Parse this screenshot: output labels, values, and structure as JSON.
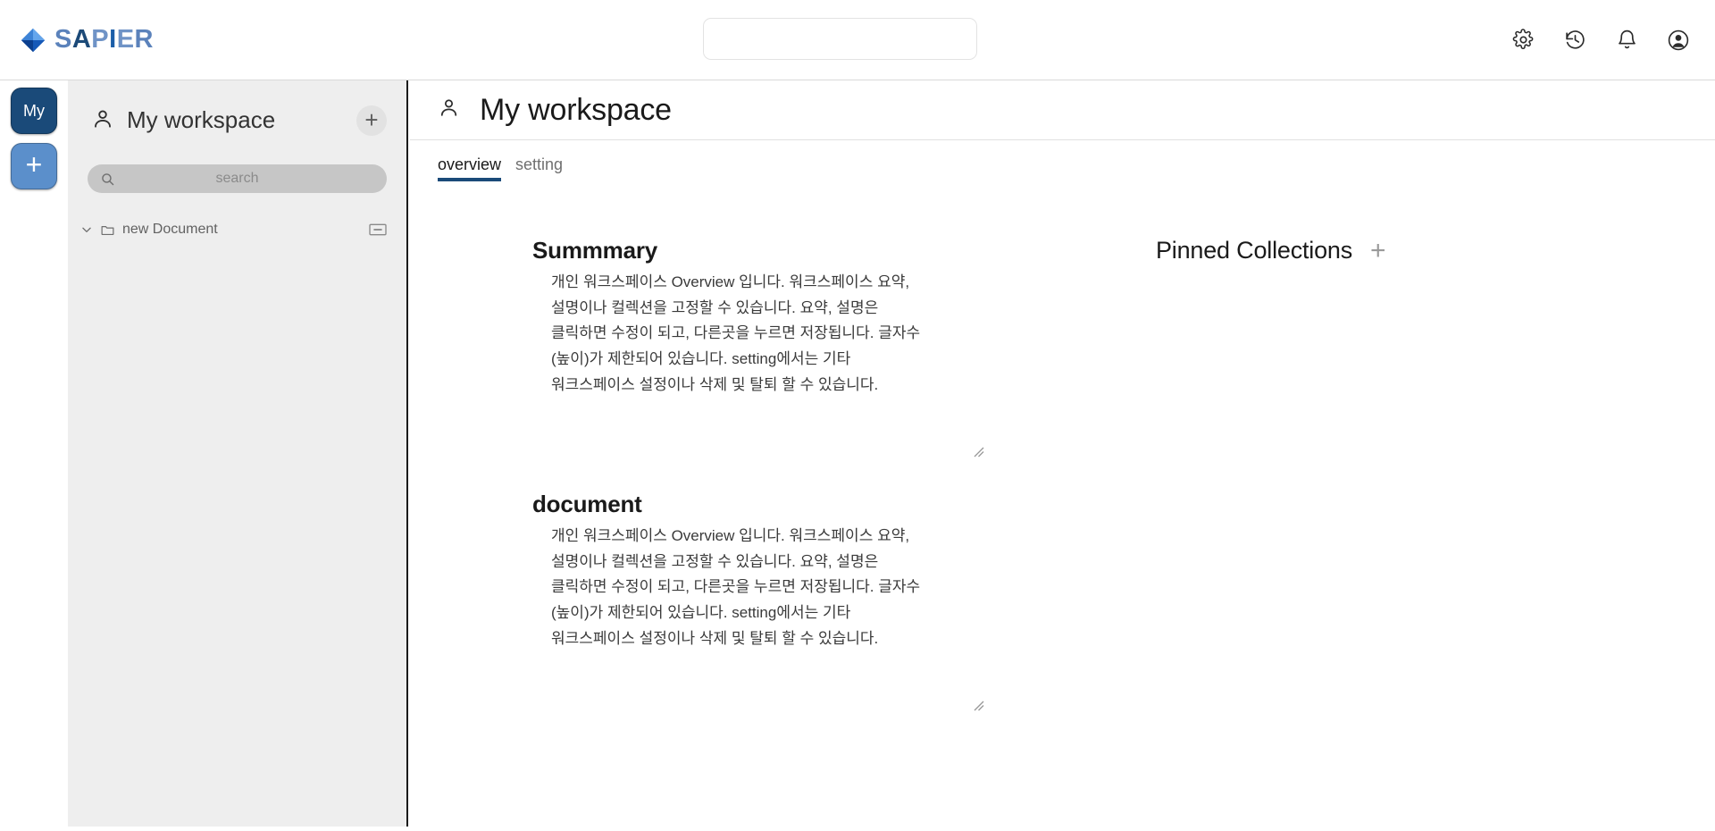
{
  "brand": {
    "name": "SAPIER",
    "logo_icon": "diamond-gem-icon",
    "accent_dark": "#1c4a78",
    "accent_light": "#6f93c6"
  },
  "topbar": {
    "search_value": "",
    "search_placeholder": "",
    "actions": [
      {
        "name": "settings",
        "icon": "gear-icon"
      },
      {
        "name": "history",
        "icon": "history-clock-icon"
      },
      {
        "name": "notifications",
        "icon": "bell-icon"
      },
      {
        "name": "account",
        "icon": "account-circle-icon"
      }
    ]
  },
  "rail": {
    "items": [
      {
        "label": "My",
        "name": "workspace-my",
        "color": "#1a4a79"
      },
      {
        "label": "+",
        "name": "add-workspace",
        "color": "#5b8fcb"
      }
    ]
  },
  "sidebar": {
    "workspace_title": "My workspace",
    "workspace_icon": "person-icon",
    "add_button_label": "+",
    "search": {
      "value": "",
      "placeholder": "search",
      "icon": "search-icon"
    },
    "tree": [
      {
        "label": "new Document",
        "expanded": true,
        "chevron_icon": "chevron-down-icon",
        "type_icon": "folder-icon",
        "row_action_icon": "collapse-rectangle-icon"
      }
    ]
  },
  "main": {
    "header": {
      "title": "My workspace",
      "icon": "person-icon"
    },
    "tabs": [
      {
        "label": "overview",
        "active": true
      },
      {
        "label": "setting",
        "active": false
      }
    ],
    "sections": [
      {
        "title": "Summmary",
        "body": "개인 워크스페이스 Overview 입니다. 워크스페이스 요약, 설명이나 컬렉션을 고정할 수 있습니다. 요약, 설명은 클릭하면 수정이 되고, 다른곳을 누르면 저장됩니다. 글자수(높이)가 제한되어 있습니다. setting에서는 기타 워크스페이스 설정이나 삭제 및 탈퇴 할 수 있습니다."
      },
      {
        "title": "document",
        "body": "개인 워크스페이스 Overview 입니다. 워크스페이스 요약, 설명이나 컬렉션을 고정할 수 있습니다. 요약, 설명은 클릭하면 수정이 되고, 다른곳을 누르면 저장됩니다. 글자수(높이)가 제한되어 있습니다. setting에서는 기타 워크스페이스 설정이나 삭제 및 탈퇴 할 수 있습니다."
      }
    ],
    "pinned": {
      "title": "Pinned Collections",
      "add_label": "+",
      "items": []
    }
  }
}
